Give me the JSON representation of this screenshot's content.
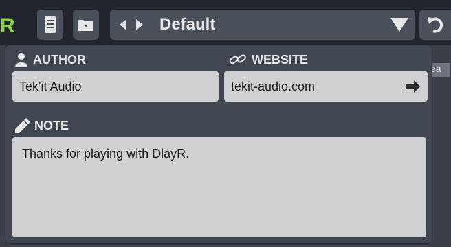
{
  "toolbar": {
    "logo_char": "R",
    "preset_name": "Default",
    "icons": {
      "info": "document-icon",
      "folder": "folder-icon",
      "prev": "triangle-left-icon",
      "next": "triangle-right-icon",
      "dropdown": "dropdown-triangle-icon",
      "undo": "undo-icon"
    }
  },
  "background": {
    "right_label": "ea"
  },
  "popup": {
    "author_label": "AUTHOR",
    "author_value": "Tek'it Audio",
    "website_label": "WEBSITE",
    "website_value": "tekit-audio.com",
    "note_label": "NOTE",
    "note_text": "Thanks for playing with DlayR."
  },
  "colors": {
    "accent_green": "#8dd14a",
    "panel": "#3f4650",
    "field": "#cfd0d2"
  }
}
